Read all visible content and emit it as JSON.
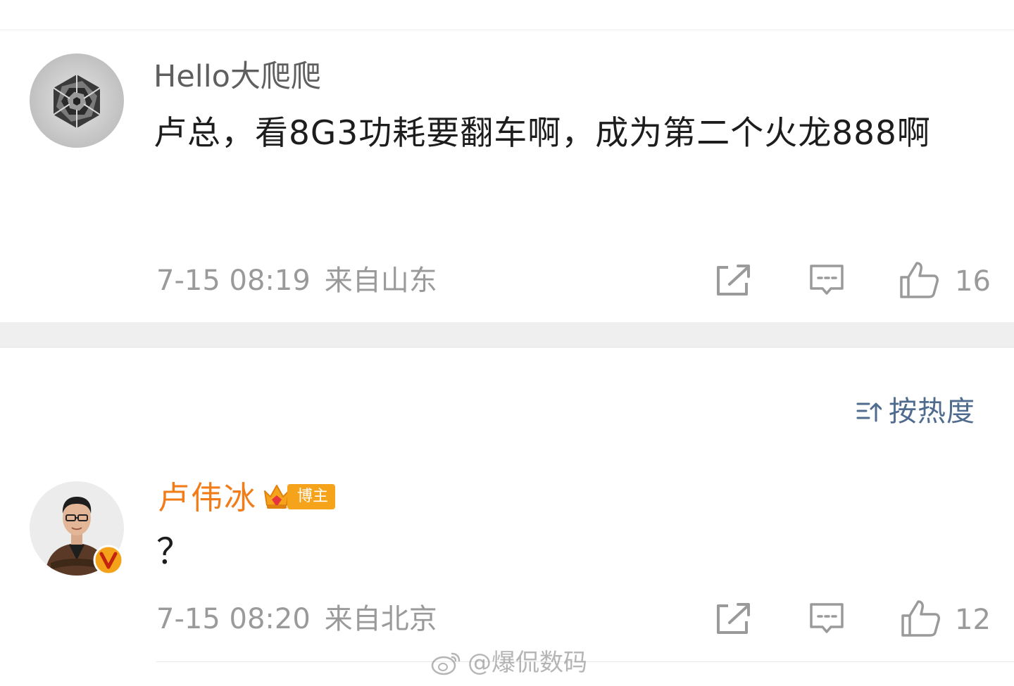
{
  "comments": [
    {
      "username": "Hello大爬爬",
      "content": "卢总，看8G3功耗要翻车啊，成为第二个火龙888啊",
      "time": "7-15 08:19",
      "location": "来自山东",
      "likes": "16",
      "avatar_icon": "geometric-rose-avatar"
    },
    {
      "username": "卢伟冰",
      "badge": "博主",
      "content": "？",
      "time": "7-15 08:20",
      "location": "来自北京",
      "likes": "12",
      "avatar_icon": "man-portrait-avatar",
      "verified_icon": "verified-v-badge-icon"
    }
  ],
  "sort": {
    "label": "按热度",
    "icon": "sort-icon"
  },
  "watermark": {
    "text": "@爆侃数码",
    "icon": "weibo-logo-icon"
  },
  "colors": {
    "username_default": "#5f5f5f",
    "username_author": "#f07d1a",
    "meta_gray": "#9a9a9a",
    "sort_blue": "#4f6c8f",
    "badge_orange": "#f5a31a",
    "section_gap": "#efefef"
  }
}
